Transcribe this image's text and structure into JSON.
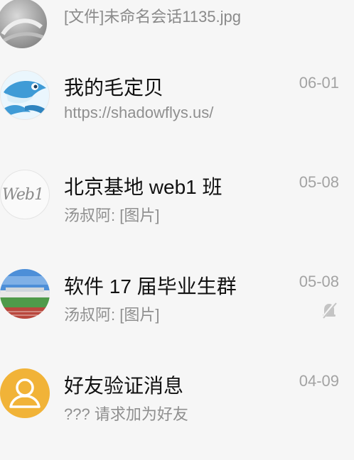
{
  "chats": [
    {
      "title": "",
      "preview": "[文件]未命名会话1135.jpg",
      "date": "",
      "muted": false,
      "avatar_icon": "gray-photo-avatar"
    },
    {
      "title": "我的毛定贝",
      "preview": "https://shadowflys.us/",
      "date": "06-01",
      "muted": false,
      "avatar_icon": "cartoon-dolphin-avatar"
    },
    {
      "title": "北京基地 web1 班",
      "preview": "汤叔阿: [图片]",
      "date": "05-08",
      "muted": false,
      "avatar_icon": "web1-logo-avatar",
      "avatar_text": "Web1"
    },
    {
      "title": "软件 17 届毕业生群",
      "preview": "汤叔阿: [图片]",
      "date": "05-08",
      "muted": true,
      "avatar_icon": "stadium-photo-avatar"
    },
    {
      "title": "好友验证消息",
      "preview": "??? 请求加为好友",
      "date": "04-09",
      "muted": false,
      "avatar_icon": "person-outline-avatar",
      "avatar_color": "#f1b338"
    }
  ]
}
